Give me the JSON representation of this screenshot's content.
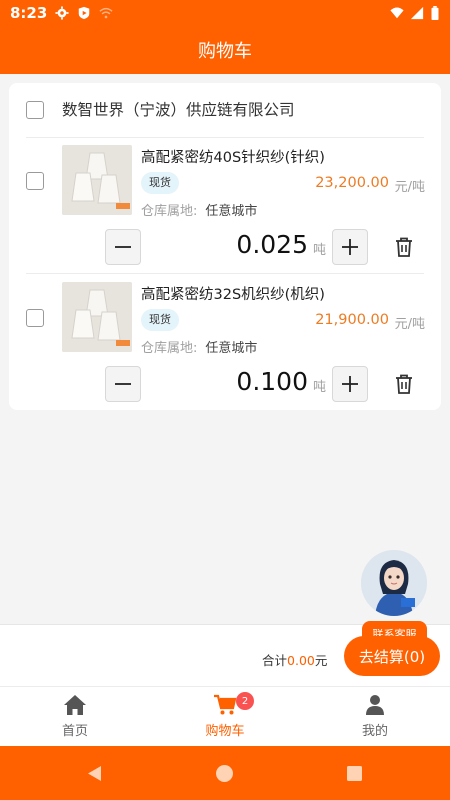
{
  "status_bar": {
    "time": "8:23"
  },
  "header": {
    "title": "购物车"
  },
  "shop": {
    "name": "数智世界（宁波）供应链有限公司"
  },
  "items": [
    {
      "title": "高配紧密纺40S针织纱(针织)",
      "badge": "现货",
      "price": "23,200.00",
      "price_unit": "元/吨",
      "warehouse_label": "仓库属地:",
      "warehouse_value": "任意城市",
      "quantity": "0.025",
      "quantity_unit": "吨"
    },
    {
      "title": "高配紧密纺32S机织纱(机织)",
      "badge": "现货",
      "price": "21,900.00",
      "price_unit": "元/吨",
      "warehouse_label": "仓库属地:",
      "warehouse_value": "任意城市",
      "quantity": "0.100",
      "quantity_unit": "吨"
    }
  ],
  "footer": {
    "total_label": "合计",
    "total_amount": "0.00",
    "total_currency": "元",
    "service_label": "联系客服",
    "checkout_label": "去结算(0)"
  },
  "tabs": [
    {
      "label": "首页",
      "icon": "home-icon"
    },
    {
      "label": "购物车",
      "icon": "cart-icon",
      "badge": "2"
    },
    {
      "label": "我的",
      "icon": "user-icon"
    }
  ],
  "colors": {
    "brand": "#ff6000",
    "price": "#ee7b22",
    "badge_bg": "#e4f4fb"
  }
}
